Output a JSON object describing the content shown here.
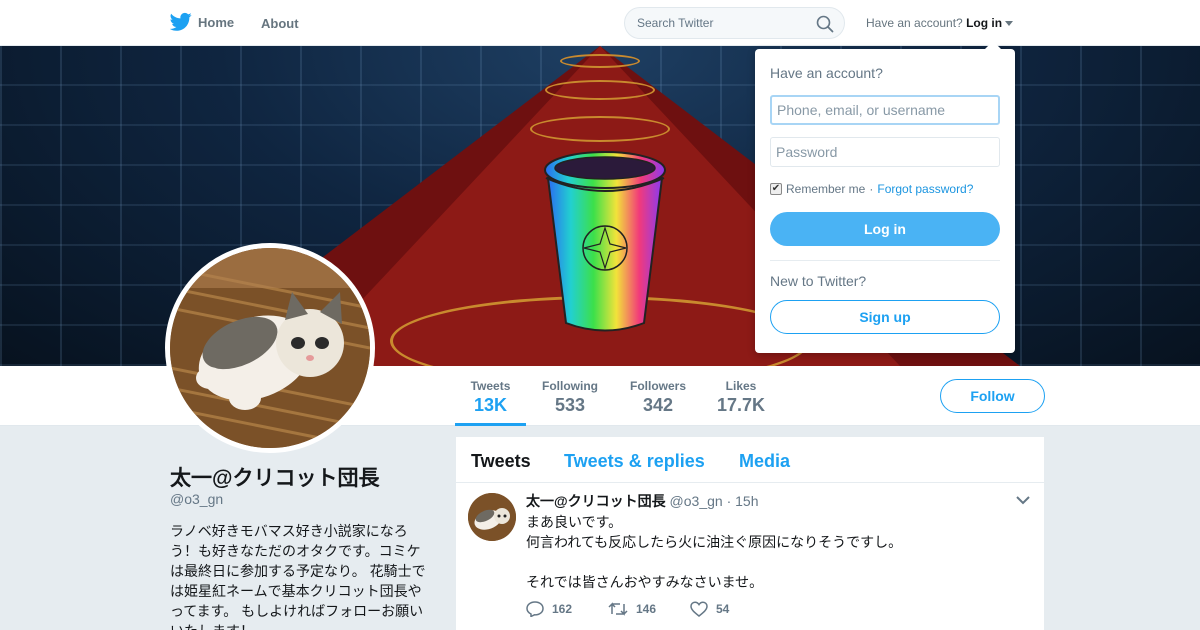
{
  "nav": {
    "home_label": "Home",
    "about_label": "About",
    "search_placeholder": "Search Twitter",
    "have_account_text": "Have an account?",
    "login_label": "Log in"
  },
  "stats": [
    {
      "label": "Tweets",
      "value": "13K",
      "active": true
    },
    {
      "label": "Following",
      "value": "533"
    },
    {
      "label": "Followers",
      "value": "342"
    },
    {
      "label": "Likes",
      "value": "17.7K"
    }
  ],
  "follow_label": "Follow",
  "profile": {
    "name": "太一@クリコット団長",
    "handle": "@o3_gn",
    "bio": "ラノベ好きモバマス好き小説家になろう！も好きなただのオタクです。コミケは最終日に参加する予定なり。 花騎士では姫星紅ネームで基本クリコット団長やってます。 もしよければフォローお願いいたします！"
  },
  "tabs": [
    {
      "label": "Tweets",
      "active": true
    },
    {
      "label": "Tweets & replies"
    },
    {
      "label": "Media"
    }
  ],
  "tweet": {
    "name": "太一@クリコット団長",
    "handle": "@o3_gn",
    "time": "· 15h",
    "text": "まあ良いです。\n何言われても反応したら火に油注ぐ原因になりそうですし。\n\nそれでは皆さんおやすみなさいませ。",
    "replies": "162",
    "retweets": "146",
    "likes": "54"
  },
  "login_popup": {
    "title": "Have an account?",
    "username_placeholder": "Phone, email, or username",
    "password_placeholder": "Password",
    "remember_label": "Remember me",
    "separator": "·",
    "forgot_label": "Forgot password?",
    "login_button": "Log in",
    "new_text": "New to Twitter?",
    "signup_button": "Sign up"
  },
  "colors": {
    "accent": "#1da1f2",
    "login_button": "#4ab3f4",
    "background": "#e6ecf0"
  }
}
